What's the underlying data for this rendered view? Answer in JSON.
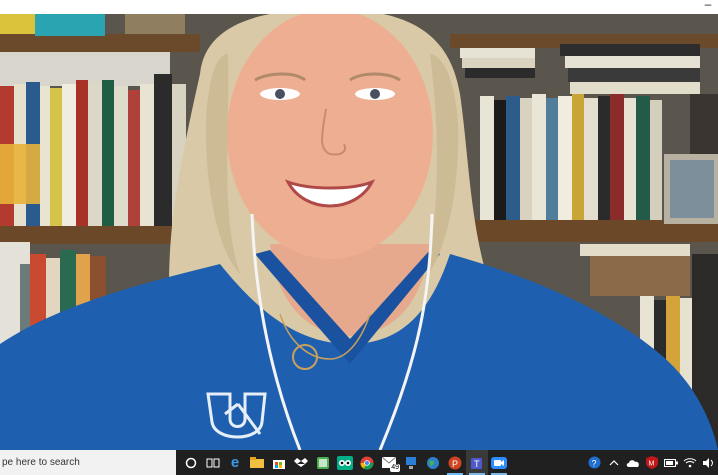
{
  "window": {
    "minimize_glyph": "–"
  },
  "taskbar": {
    "search_text": "pe here to search",
    "pinned": [
      {
        "name": "cortana-icon"
      },
      {
        "name": "task-view-icon"
      },
      {
        "name": "edge-icon"
      },
      {
        "name": "file-explorer-icon"
      },
      {
        "name": "store-icon"
      },
      {
        "name": "dropbox-icon"
      },
      {
        "name": "photos-icon"
      },
      {
        "name": "tripadvisor-icon"
      },
      {
        "name": "chrome-icon"
      },
      {
        "name": "mail-icon",
        "badge": "49"
      },
      {
        "name": "network-icon"
      },
      {
        "name": "globe-icon"
      },
      {
        "name": "powerpoint-icon"
      },
      {
        "name": "teams-icon"
      },
      {
        "name": "zoom-icon"
      }
    ],
    "tray": [
      {
        "name": "help-icon"
      },
      {
        "name": "chevron-up-icon"
      },
      {
        "name": "cloud-icon"
      },
      {
        "name": "mcafee-icon"
      },
      {
        "name": "battery-icon"
      },
      {
        "name": "wifi-icon"
      },
      {
        "name": "volume-icon"
      }
    ]
  },
  "colors": {
    "shirt_blue": "#1f5fb0",
    "hair_blonde": "#d9c9a6",
    "taskbar_bg": "#202020",
    "accent": "#76b9ed"
  }
}
